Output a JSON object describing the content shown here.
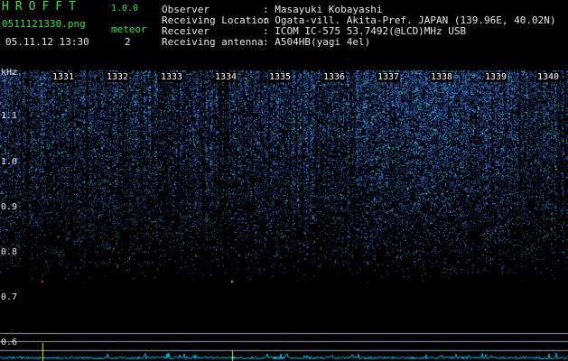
{
  "header": {
    "brand": "HROFFT",
    "version": "1.0.0",
    "filename": "0511121330.png",
    "datetime": "05.11.12 13:30",
    "meteor_label": "meteor",
    "meteor_count": "2"
  },
  "info": [
    {
      "label": "Observer",
      "value": ": Masayuki Kobayashi"
    },
    {
      "label": "Receiving Location",
      "value": ": Ogata-vill. Akita-Pref. JAPAN (139.96E, 40.02N)"
    },
    {
      "label": "Receiver",
      "value": ": ICOM IC-575 53.7492(@LCD)MHz USB"
    },
    {
      "label": "Receiving antenna",
      "value": ": A504HB(yagi 4el)"
    }
  ],
  "axis": {
    "unit": "kHz",
    "y_labels": [
      "1.1",
      "1.0",
      "0.9",
      "0.8",
      "0.7",
      "0.6"
    ],
    "minute_labels": [
      "1331",
      "1332",
      "1333",
      "1334",
      "1335",
      "1336",
      "1337",
      "1338",
      "1339",
      "1340"
    ]
  },
  "colors": {
    "noise_low": "#0a1a6e",
    "noise_high": "#6fa8ff",
    "highlight": "#00ff66",
    "text_green": "#39e04a"
  }
}
